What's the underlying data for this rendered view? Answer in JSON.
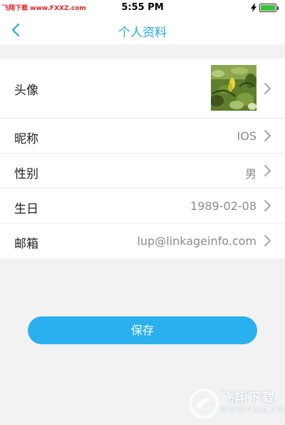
{
  "status_bar": {
    "watermark": "飞翔下载 www.FXXZ.com",
    "time": "5:55 PM"
  },
  "nav": {
    "title": "个人资料",
    "back_icon": "chevron-left-icon"
  },
  "profile": {
    "avatar_label": "头像",
    "rows": [
      {
        "label": "昵称",
        "value": "IOS"
      },
      {
        "label": "性别",
        "value": "男"
      },
      {
        "label": "生日",
        "value": "1989-02-08"
      },
      {
        "label": "邮箱",
        "value": "lup@linkageinfo.com"
      }
    ]
  },
  "save_label": "保存",
  "watermark_logo": {
    "text": "飞翔下载",
    "sub": "WWW.FXXZ.COM"
  },
  "colors": {
    "accent": "#24a6e8",
    "button": "#2ab0ee",
    "battery": "#3cc23a"
  }
}
